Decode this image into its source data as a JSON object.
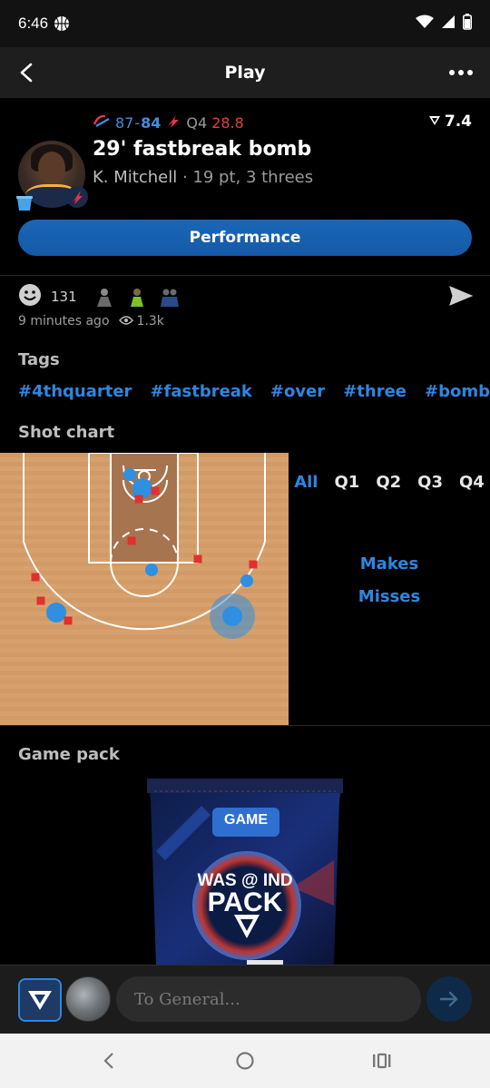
{
  "status_bar": {
    "time": "6:46",
    "time_icon": "basketball-icon",
    "icons": [
      "wifi-icon",
      "cell-signal-icon",
      "battery-icon"
    ]
  },
  "app_bar": {
    "title": "Play",
    "back_icon": "back-arrow-icon",
    "more_icon": "more-dots-icon"
  },
  "play": {
    "away_logo": "wizards-logo-icon",
    "away_score": "87",
    "separator": "-",
    "home_score": "84",
    "home_logo": "fever-logo-icon",
    "quarter": "Q4",
    "clock": "28.8",
    "rating": "7.4",
    "rating_icon": "vertical-logo-icon",
    "title": "29' fastbreak bomb",
    "player": "K. Mitchell",
    "stat_line": "· 19 pt, 3 threes",
    "performance_button": "Performance"
  },
  "reactions": {
    "emoji_icon": "smiley-icon",
    "count": "131",
    "send_icon": "send-icon"
  },
  "meta": {
    "time_ago": "9 minutes ago",
    "views": "1.3k",
    "views_icon": "eye-icon"
  },
  "tags": {
    "label": "Tags",
    "items": [
      "#4thquarter",
      "#fastbreak",
      "#over",
      "#three",
      "#bomb"
    ]
  },
  "shot_chart": {
    "label": "Shot chart",
    "filters": {
      "all": "All",
      "quarters": [
        "Q1",
        "Q2",
        "Q3",
        "Q4"
      ],
      "makes": "Makes",
      "misses": "Misses"
    },
    "colors": {
      "court": "#d49c6a",
      "paint": "#a9764f",
      "make": "#2f8fe0",
      "miss": "#e0312e"
    }
  },
  "game_pack": {
    "label": "Game pack",
    "badge": "GAME",
    "matchup": "WAS @ IND",
    "pack": "PACK"
  },
  "composer": {
    "placeholder": "To General..."
  },
  "colors": {
    "accent": "#2e86e0",
    "background": "#000000",
    "live": "#e0433b"
  }
}
